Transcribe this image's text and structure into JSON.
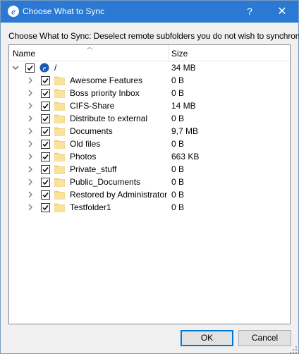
{
  "window": {
    "title": "Choose What to Sync",
    "help_label": "?",
    "close_label": "✕",
    "titlebar_color": "#2b79d2"
  },
  "instruction": "Choose What to Sync: Deselect remote subfolders you do not wish to synchronize.",
  "columns": {
    "name": "Name",
    "size": "Size"
  },
  "root": {
    "name": "/",
    "size": "34 MB",
    "checked": true,
    "expanded": true
  },
  "folders": [
    {
      "name": "Awesome Features",
      "size": "0 B",
      "checked": true
    },
    {
      "name": "Boss priority Inbox",
      "size": "0 B",
      "checked": true
    },
    {
      "name": "CIFS-Share",
      "size": "14 MB",
      "checked": true
    },
    {
      "name": "Distribute to external",
      "size": "0 B",
      "checked": true
    },
    {
      "name": "Documents",
      "size": "9,7 MB",
      "checked": true
    },
    {
      "name": "Old files",
      "size": "0 B",
      "checked": true
    },
    {
      "name": "Photos",
      "size": "663 KB",
      "checked": true
    },
    {
      "name": "Private_stuff",
      "size": "0 B",
      "checked": true
    },
    {
      "name": "Public_Documents",
      "size": "0 B",
      "checked": true
    },
    {
      "name": "Restored by Administrator",
      "size": "0 B",
      "checked": true
    },
    {
      "name": "Testfolder1",
      "size": "0 B",
      "checked": true
    }
  ],
  "buttons": {
    "ok": "OK",
    "cancel": "Cancel"
  },
  "icons": {
    "app": "nextcloud-e-icon",
    "folder": "folder-icon",
    "expander_collapsed": "chevron-right-icon",
    "expander_expanded": "chevron-down-icon"
  },
  "colors": {
    "folder": "#f8d775",
    "accent": "#0078d7"
  }
}
